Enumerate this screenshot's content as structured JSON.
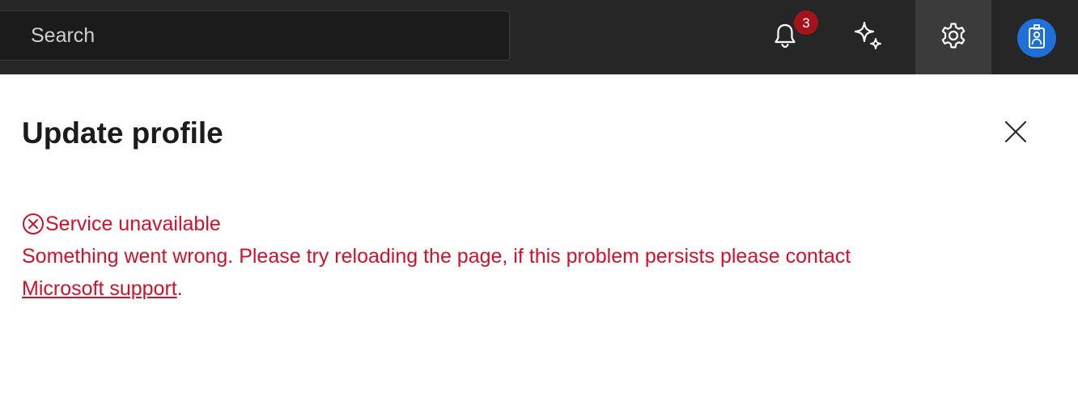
{
  "topbar": {
    "search": {
      "placeholder": "Search",
      "value": ""
    },
    "notifications": {
      "icon": "bell-icon",
      "badge_count": "3",
      "badge_color": "#a4131b"
    },
    "copilot": {
      "icon": "sparkle-icon"
    },
    "settings": {
      "icon": "gear-icon",
      "active": true
    },
    "avatar": {
      "icon": "user-badge-icon",
      "color": "#1f6fd8"
    }
  },
  "panel": {
    "title": "Update profile",
    "close_icon": "close-icon",
    "error": {
      "icon": "error-circle-icon",
      "title": "Service unavailable",
      "message": "Something went wrong. Please try reloading the page, if this problem persists please contact",
      "link_text": "Microsoft support",
      "trailing": ".",
      "color": "#d1112b"
    }
  }
}
